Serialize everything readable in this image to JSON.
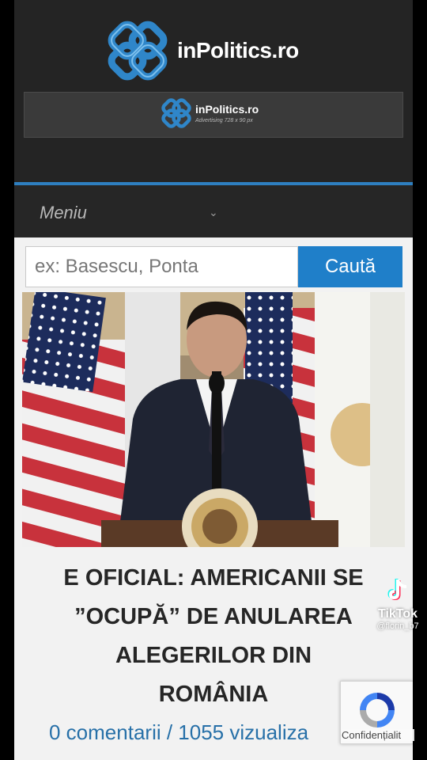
{
  "header": {
    "logo_text": "inPolitics.ro",
    "ad_logo_text": "inPolitics.ro",
    "ad_caption": "Advertising 728 x 90 px"
  },
  "nav": {
    "menu_label": "Meniu"
  },
  "search": {
    "placeholder": "ex: Basescu, Ponta",
    "button_label": "Caută"
  },
  "article": {
    "headline_lines": [
      "E OFICIAL: AMERICANII SE",
      "”OCUPĂ” DE ANULAREA",
      "ALEGERILOR DIN",
      "ROMÂNIA"
    ],
    "meta": "0 comentarii / 1055 vizualiza"
  },
  "overlay": {
    "tiktok_label": "TikTok",
    "tiktok_user": "@florin_b7",
    "recaptcha_caption": "Confidențialit"
  },
  "colors": {
    "accent": "#1f7fc9",
    "header_bg": "#242424",
    "link": "#2770a8"
  }
}
